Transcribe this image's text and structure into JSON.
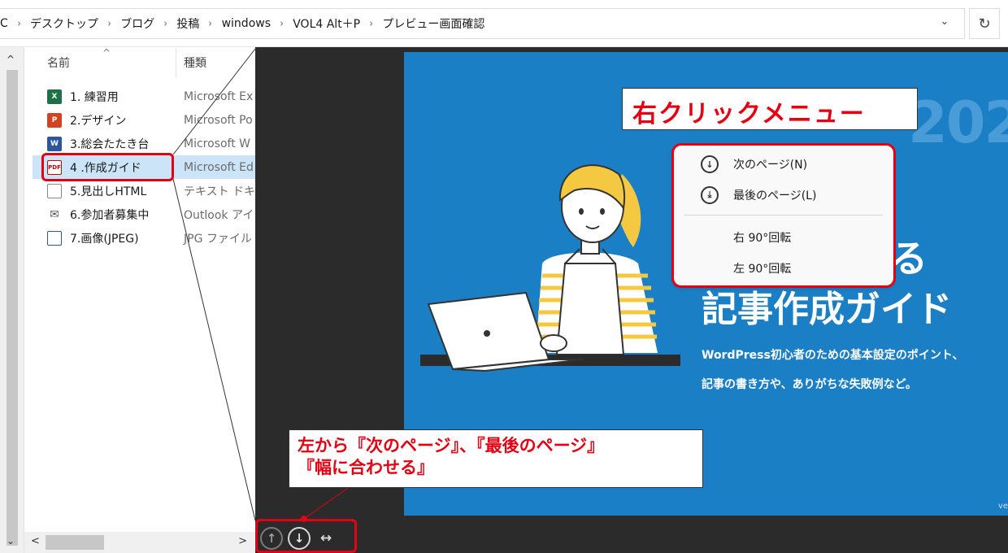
{
  "address_bar": {
    "crumbs": [
      "C",
      "デスクトップ",
      "ブログ",
      "投稿",
      "windows",
      "VOL4 Alt＋P",
      "プレビュー画面確認"
    ],
    "separator": "›",
    "dropdown": "⌄",
    "refresh": "↻"
  },
  "nav": {
    "scroll_up": "^",
    "scroll_down": "⌄"
  },
  "filelist": {
    "col_name": "名前",
    "col_type": "種類",
    "sort_caret": "^",
    "rows": [
      {
        "name": "1. 練習用",
        "type": "Microsoft Ex",
        "icon": "excel-icon",
        "badge": "X"
      },
      {
        "name": "2.デザイン",
        "type": "Microsoft Po",
        "icon": "powerpoint-icon",
        "badge": "P"
      },
      {
        "name": "3.総会たたき台",
        "type": "Microsoft W",
        "icon": "word-icon",
        "badge": "W"
      },
      {
        "name": "4 .作成ガイド",
        "type": "Microsoft Ed",
        "icon": "pdf-icon",
        "badge": "PDF"
      },
      {
        "name": "5.見出しHTML",
        "type": "テキスト ドキュ",
        "icon": "text-file-icon",
        "badge": ""
      },
      {
        "name": "6.参加者募集中",
        "type": "Outlook アイ",
        "icon": "mail-icon",
        "badge": "✉"
      },
      {
        "name": "7.画像(JPEG)",
        "type": "JPG ファイル",
        "icon": "image-icon",
        "badge": ""
      }
    ],
    "hscroll_left": "<",
    "hscroll_right": ">"
  },
  "preview": {
    "page_year": "202",
    "title_line1": "で作る",
    "title_line2": "記事作成ガイド",
    "subtitle_line1": "WordPress初心者のための基本設定のポイント、",
    "subtitle_line2": "記事の書き方や、ありがちな失敗例など。",
    "page_footer": "ve",
    "toolbar": {
      "prev": "↑",
      "next": "↓",
      "fit": "↔"
    }
  },
  "context_menu": {
    "items": [
      {
        "label": "次のページ(N)",
        "icon": "↓"
      },
      {
        "label": "最後のページ(L)",
        "icon": "⤓"
      },
      {
        "label": "右 90°回転",
        "icon": ""
      },
      {
        "label": "左 90°回転",
        "icon": ""
      }
    ]
  },
  "annotations": {
    "callout_menu": "右クリックメニュー",
    "callout_toolbar_line1": "左から『次のページ』、『最後のページ』",
    "callout_toolbar_line2": "『幅に合わせる』",
    "accent_color": "#e60012"
  }
}
